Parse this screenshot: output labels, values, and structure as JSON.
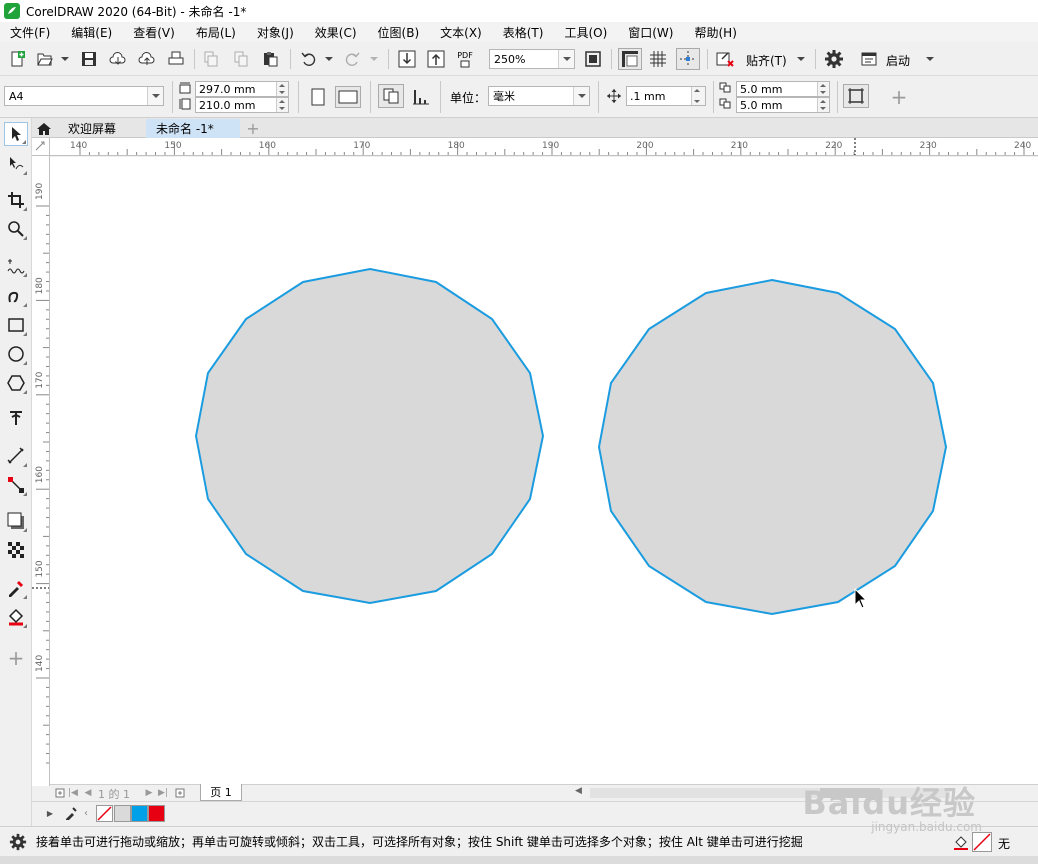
{
  "window": {
    "title": "CorelDRAW 2020 (64-Bit) - 未命名 -1*"
  },
  "menu": [
    "文件(F)",
    "编辑(E)",
    "查看(V)",
    "布局(L)",
    "对象(J)",
    "效果(C)",
    "位图(B)",
    "文本(X)",
    "表格(T)",
    "工具(O)",
    "窗口(W)",
    "帮助(H)"
  ],
  "toolbar": {
    "zoom_value": "250%",
    "snap_label": "贴齐(T)",
    "launch_label": "启动",
    "pdf_label": "PDF"
  },
  "propertybar": {
    "page_size": "A4",
    "width": "297.0 mm",
    "height": "210.0 mm",
    "units_label": "单位：",
    "units_value": "毫米",
    "nudge": ".1 mm",
    "dup_x": "5.0 mm",
    "dup_y": "5.0 mm"
  },
  "tabs": [
    {
      "label": "欢迎屏幕",
      "active": false
    },
    {
      "label": "未命名 -1*",
      "active": true
    }
  ],
  "rulers": {
    "h_ticks": [
      "140",
      "150",
      "160",
      "170",
      "180",
      "190",
      "200",
      "210",
      "220",
      "230",
      "240"
    ],
    "v_ticks": [
      "190",
      "180",
      "170",
      "160",
      "150",
      "140"
    ]
  },
  "pagenav": {
    "page_indicator": "1 的 1",
    "current_page_tab": "页 1"
  },
  "palette": {
    "swatches": [
      "#ffffff",
      "#dadada",
      "#00a0e9",
      "#e60012"
    ]
  },
  "colors": {
    "shape_fill": "#d9d9d9",
    "shape_outline": "#1b9ce0",
    "active_tab_bg": "#cfe3f7"
  },
  "status": {
    "message": "接着单击可进行拖动或缩放；再单击可旋转或倾斜；双击工具，可选择所有对象；按住 Shift 键单击可选择多个对象；按住 Alt 键单击可进行挖掘",
    "fill_label": "无"
  },
  "watermark": {
    "brand": "Baidu经验",
    "url": "jingyan.baidu.com"
  }
}
